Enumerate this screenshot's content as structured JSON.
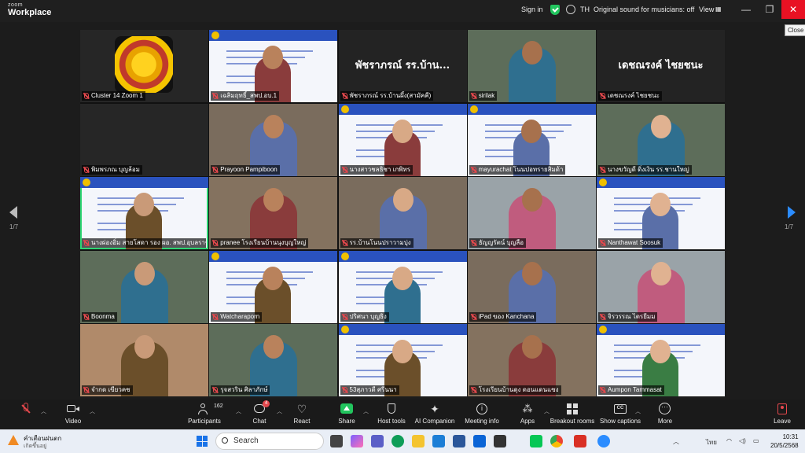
{
  "titlebar": {
    "brand_line1": "zoom",
    "brand_line2": "Workplace",
    "sign_in": "Sign in",
    "lang": "TH",
    "sound": "Original sound for musicians: off",
    "view": "View",
    "close_tooltip": "Close"
  },
  "grid": {
    "page_left": "1/7",
    "page_right": "1/7",
    "tiles": [
      {
        "name": "Cluster 14 Zoom 1",
        "kind": "logo",
        "big": ""
      },
      {
        "name": "เฉลิมฤทธิ์_สพป.อบ.1",
        "kind": "slide",
        "big": ""
      },
      {
        "name": "พัชราภรณ์ รร.บ้านผึ้ง(สามัคคี)",
        "kind": "name",
        "big": "พัชราภรณ์ รร.บ้าน..."
      },
      {
        "name": "sirilak",
        "kind": "photo",
        "big": ""
      },
      {
        "name": "เดชณรงค์ ไชยชนะ",
        "kind": "name",
        "big": "เดชณรงค์ ไชยชนะ"
      },
      {
        "name": "พิมพรภณ บุญล้อม",
        "kind": "dark",
        "big": ""
      },
      {
        "name": "Prayoon Pampiboon",
        "kind": "photo",
        "big": ""
      },
      {
        "name": "นางสาวชลธิชา เกพิทร",
        "kind": "slide",
        "big": ""
      },
      {
        "name": "mayurachat โนนปอทรายสิมด้า",
        "kind": "slide",
        "big": ""
      },
      {
        "name": "นางขวัญดี ดิ่งเงิน รร.ชานใหญ่",
        "kind": "photo",
        "big": ""
      },
      {
        "name": "นางผ่องอิ่ม สายโสดา รอง ผอ. สพป.อุบลราชธานี เ...",
        "kind": "slide",
        "big": ""
      },
      {
        "name": "pranee โรงเรียนบ้านนุงบุญใหญ่",
        "kind": "photo",
        "big": ""
      },
      {
        "name": "รร.บ้านโนนปราวามบุ่ง",
        "kind": "photo",
        "big": ""
      },
      {
        "name": "ธัญญรัตน์ บุญลือ",
        "kind": "photo",
        "big": ""
      },
      {
        "name": "Nanthawat Soosuk",
        "kind": "slide",
        "big": ""
      },
      {
        "name": "Boonma",
        "kind": "photo",
        "big": ""
      },
      {
        "name": "Watcharaporn",
        "kind": "slide",
        "big": ""
      },
      {
        "name": "ปริศนา บุญธิง",
        "kind": "slide",
        "big": ""
      },
      {
        "name": "iPad ของ Kanchana",
        "kind": "photo",
        "big": ""
      },
      {
        "name": "จิรวรรณ ไตรยีมม",
        "kind": "photo",
        "big": ""
      },
      {
        "name": "จำกด เขียวคช",
        "kind": "photo",
        "big": ""
      },
      {
        "name": "รุจสวริน ศิลาภักษ์",
        "kind": "photo",
        "big": ""
      },
      {
        "name": "53สุภาวดี ศรีนนา",
        "kind": "slide",
        "big": ""
      },
      {
        "name": "โรงเรียนบ้านดุง ดอนแดนแซง",
        "kind": "photo",
        "big": ""
      },
      {
        "name": "Aumpon Tammasat",
        "kind": "slide",
        "big": ""
      }
    ]
  },
  "toolbar": {
    "mute": "Unmute",
    "video": "Video",
    "participants": "Participants",
    "participants_count": "162",
    "chat": "Chat",
    "chat_badge": "4",
    "react": "React",
    "share": "Share",
    "host_tools": "Host tools",
    "ai": "AI Companion",
    "meeting_info": "Meeting info",
    "apps": "Apps",
    "breakout": "Breakout rooms",
    "captions": "Show captions",
    "more": "More",
    "leave": "Leave"
  },
  "taskbar": {
    "weather_title": "คำเตือนฝนตก",
    "weather_sub": "เกิดขึ้นอยู่",
    "search": "Search",
    "lang": "ไทย",
    "time": "10:31",
    "date": "20/5/2568"
  },
  "colors": {
    "accent": "#2b8cff",
    "active_speaker": "#2ed573",
    "muted": "#e5484d",
    "close": "#e81123"
  }
}
